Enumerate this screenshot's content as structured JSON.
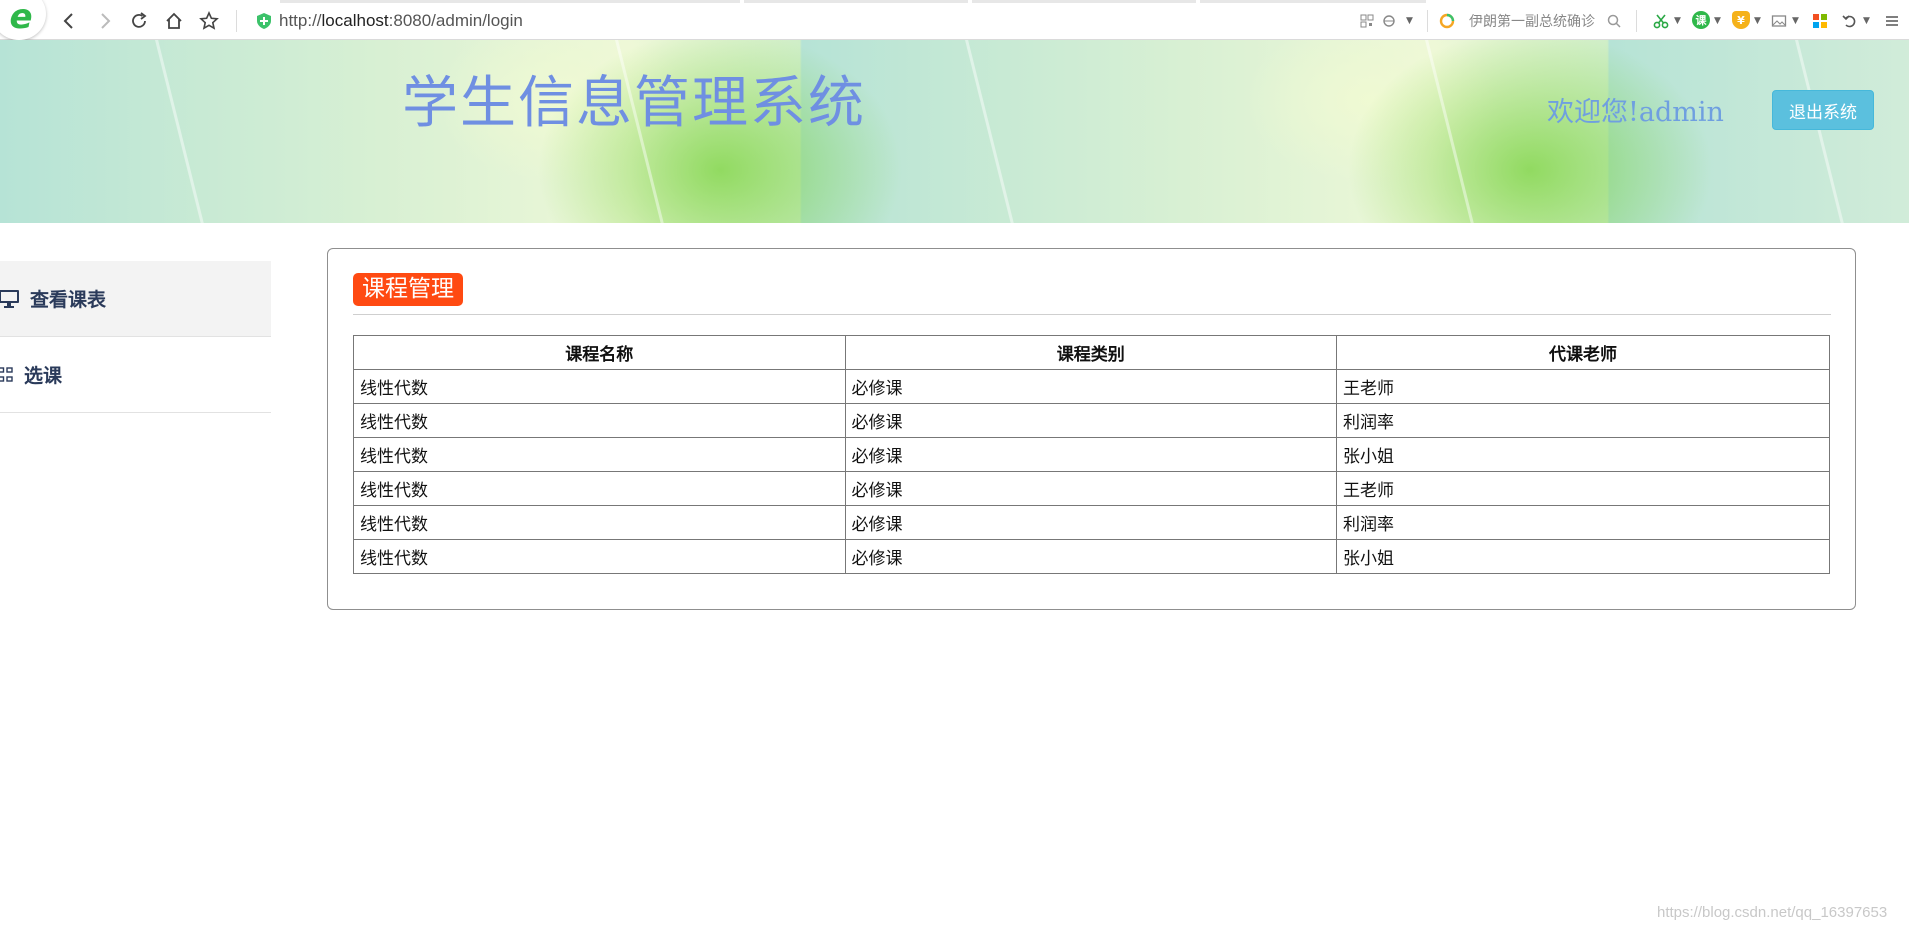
{
  "browser": {
    "url_prefix": "http://",
    "url_host": "localhost",
    "url_rest": ":8080/admin/login",
    "search_text": "伊朗第一副总统确诊",
    "icons": [
      "back-icon",
      "forward-icon",
      "reload-icon",
      "home-icon",
      "star-icon",
      "shield-icon",
      "qr-icon",
      "compat-icon",
      "search-icon",
      "scissors-icon",
      "course-ext-icon",
      "shield-ext-icon",
      "image-icon",
      "apps-icon",
      "undo-icon",
      "menu-icon"
    ],
    "course_ext_label": "课",
    "shield_ext_label": "¥",
    "logo_letter": "e"
  },
  "header": {
    "title": "学生信息管理系统",
    "welcome": "欢迎您!admin",
    "logout_label": "退出系统"
  },
  "sidebar": {
    "items": [
      {
        "label": "查看课表",
        "icon": "monitor-icon",
        "active": true
      },
      {
        "label": "选课",
        "icon": "grid-icon",
        "active": false
      }
    ]
  },
  "panel": {
    "title": "课程管理",
    "columns": [
      "课程名称",
      "课程类别",
      "代课老师"
    ],
    "rows": [
      [
        "线性代数",
        "必修课",
        "王老师"
      ],
      [
        "线性代数",
        "必修课",
        "利润率"
      ],
      [
        "线性代数",
        "必修课",
        "张小姐"
      ],
      [
        "线性代数",
        "必修课",
        "王老师"
      ],
      [
        "线性代数",
        "必修课",
        "利润率"
      ],
      [
        "线性代数",
        "必修课",
        "张小姐"
      ]
    ]
  },
  "watermark": "https://blog.csdn.net/qq_16397653",
  "colors": {
    "title_badge": "#ff4a12",
    "logout_button": "#5bc0de",
    "header_title": "#6f8fe2",
    "sidebar_text": "#2a3a5a"
  }
}
